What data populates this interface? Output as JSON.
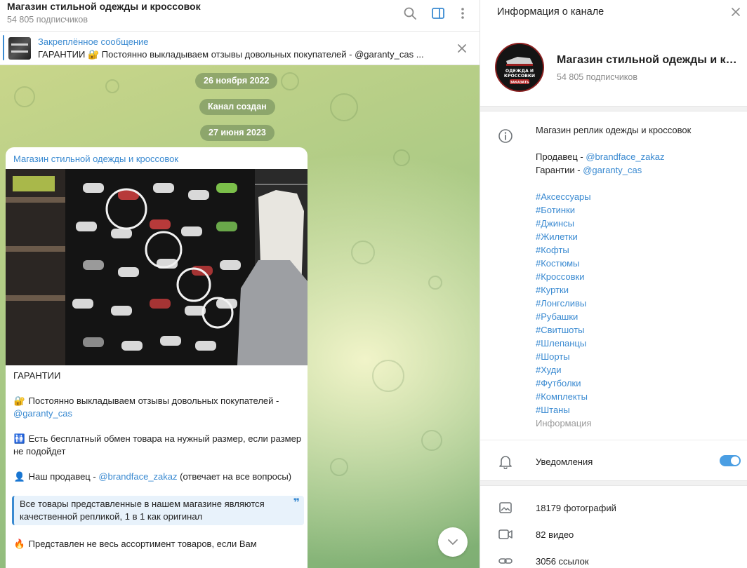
{
  "chat": {
    "title": "Магазин стильной одежды и кроссовок",
    "subtitle": "54 805 подписчиков"
  },
  "pinned": {
    "title": "Закреплённое сообщение",
    "text": "ГАРАНТИИ  🔐 Постоянно выкладываем отзывы довольных покупателей - @garanty_cas ..."
  },
  "dates": [
    "26 ноября 2022",
    "Канал создан",
    "27 июня 2023"
  ],
  "post": {
    "author": "Магазин стильной одежды и кроссовок",
    "line_guarantees": "ГАРАНТИИ",
    "reviews_prefix": "Постоянно выкладываем отзывы довольных покупателей - ",
    "reviews_link": "@garanty_cas",
    "exchange_text": "Есть бесплатный обмен товара на нужный размер, если размер не подойдет",
    "seller_prefix": "Наш продавец - ",
    "seller_link": "@brandface_zakaz",
    "seller_suffix": " (отвечает на все вопросы)",
    "quote": "Все товары представленные в нашем магазине являются качественной репликой, 1 в 1 как оригинал",
    "quote_mark": "❞",
    "last_line": "Представлен не весь ассортимент товаров, если Вам"
  },
  "info": {
    "header_title": "Информация о канале",
    "channel_name": "Магазин стильной одежды и кроссовок",
    "channel_subs": "54 805 подписчиков",
    "avatar_text": "ОДЕЖДА И КРОССОВКИ",
    "avatar_badge": "ЗАКАЗАТЬ",
    "about_text": "Магазин реплик одежды и кроссовок",
    "seller_prefix": "Продавец - ",
    "seller_link": "@brandface_zakaz",
    "guarantee_prefix": "Гарантии - ",
    "guarantee_link": "@garanty_cas",
    "tags": [
      "#Аксессуары",
      "#Ботинки",
      "#Джинсы",
      "#Жилетки",
      "#Кофты",
      "#Костюмы",
      "#Кроссовки",
      "#Куртки",
      "#Лонгсливы",
      "#Рубашки",
      "#Свитшоты",
      "#Шлепанцы",
      "#Шорты",
      "#Худи",
      "#Футболки",
      "#Комплекты",
      "#Штаны"
    ],
    "about_label": "Информация",
    "notifications_label": "Уведомления",
    "notifications_on": true,
    "photos_label": "18179 фотографий",
    "videos_label": "82 видео",
    "links_label": "3056 ссылок"
  }
}
